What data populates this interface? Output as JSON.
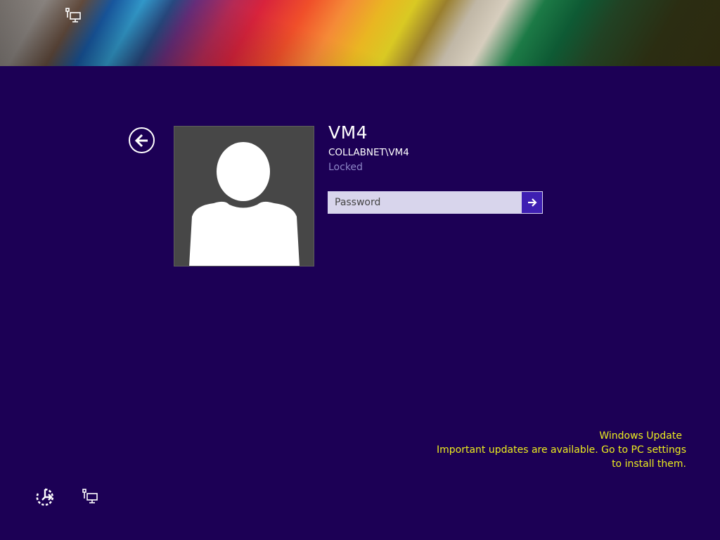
{
  "lock_screen": {
    "user": {
      "name": "VM4",
      "domain": "COLLABNET\\VM4",
      "status": "Locked"
    },
    "password": {
      "placeholder": "Password",
      "value": ""
    },
    "notification": {
      "title": "Windows Update",
      "message": "Important updates are available. Go to PC settings to install them."
    },
    "icons": {
      "back": "back-arrow-icon",
      "submit": "arrow-right-icon",
      "ease_of_access": "ease-of-access-icon",
      "network": "network-icon",
      "avatar": "user-avatar-icon"
    },
    "colors": {
      "background": "#1c0055",
      "submit_button": "#3e1fb2",
      "notification_text": "#ecec1e",
      "status_text": "#8d86c7"
    }
  }
}
